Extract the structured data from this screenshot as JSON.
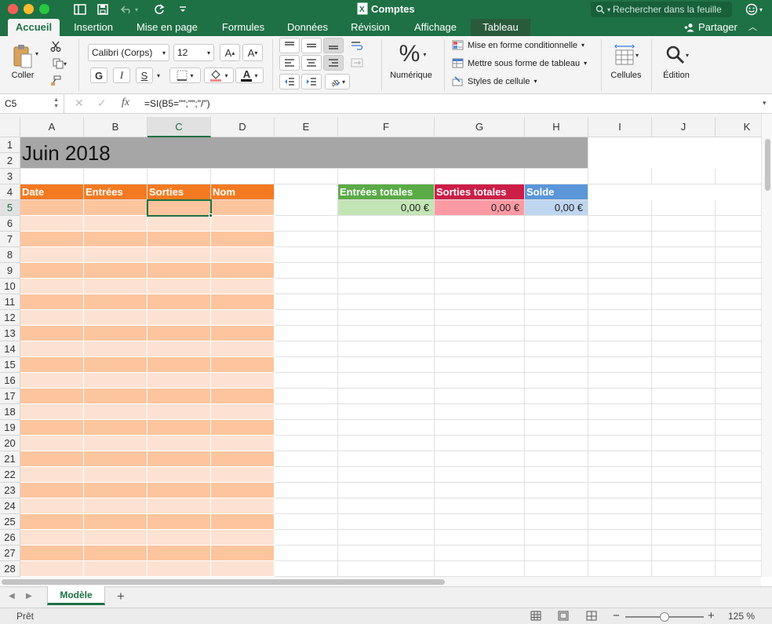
{
  "window": {
    "title": "Comptes",
    "search_placeholder": "Rechercher dans la feuille"
  },
  "tabs": [
    {
      "label": "Accueil"
    },
    {
      "label": "Insertion"
    },
    {
      "label": "Mise en page"
    },
    {
      "label": "Formules"
    },
    {
      "label": "Données"
    },
    {
      "label": "Révision"
    },
    {
      "label": "Affichage"
    },
    {
      "label": "Tableau"
    }
  ],
  "share_label": "Partager",
  "ribbon": {
    "paste_label": "Coller",
    "font_name": "Calibri (Corps)",
    "font_size": "12",
    "bold": "G",
    "italic": "I",
    "underline": "S",
    "number_label": "Numérique",
    "conditional_format": "Mise en forme conditionnelle",
    "format_as_table": "Mettre sous forme de tableau",
    "cell_styles": "Styles de cellule",
    "cells_label": "Cellules",
    "edit_label": "Édition"
  },
  "formula_bar": {
    "cell_ref": "C5",
    "fx": "fx",
    "formula": "=SI(B5=\"\";\"\";\"/\")"
  },
  "sheet": {
    "columns": [
      "A",
      "B",
      "C",
      "D",
      "E",
      "F",
      "G",
      "H",
      "I",
      "J",
      "K"
    ],
    "title": "Juin 2018",
    "table_headers": [
      "Date",
      "Entrées",
      "Sorties",
      "Nom"
    ],
    "summary_headers": [
      "Entrées totales",
      "Sorties totales",
      "Solde"
    ],
    "summary_values": [
      "0,00 €",
      "0,00 €",
      "0,00 €"
    ],
    "rows": [
      "1",
      "2",
      "3",
      "4",
      "5",
      "6",
      "7",
      "8",
      "9",
      "10",
      "11",
      "12",
      "13",
      "14",
      "15",
      "16",
      "17",
      "18",
      "19",
      "20",
      "21",
      "22",
      "23",
      "24",
      "25",
      "26",
      "27",
      "28"
    ]
  },
  "colors": {
    "ribbon_green": "#1e7145",
    "title_bg": "#a6a6a6",
    "table_header": "#f47a21",
    "band_dark": "#fcc59e",
    "band_light": "#fde2d3",
    "entrees_header": "#5aab46",
    "entrees_value": "#c3e5b5",
    "sorties_header": "#cc1e47",
    "sorties_value": "#fc9aa4",
    "solde_header": "#5a96d8",
    "solde_value": "#bed6f0"
  },
  "sheet_tabs": [
    {
      "label": "Modèle"
    }
  ],
  "status": {
    "ready": "Prêt",
    "zoom": "125 %"
  }
}
